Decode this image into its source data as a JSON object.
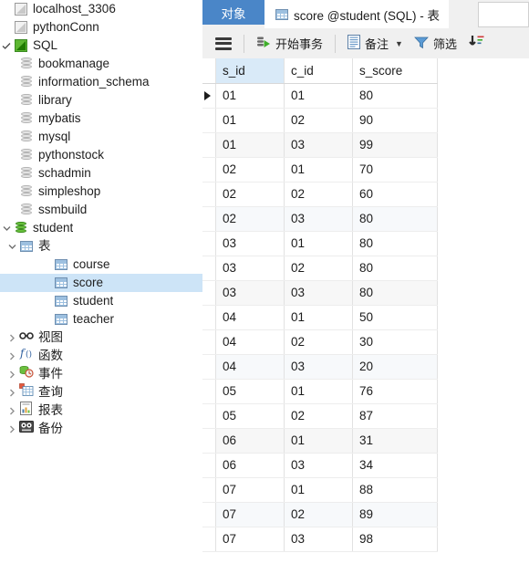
{
  "sidebar": {
    "items": [
      {
        "label": "localhost_3306",
        "icon": "connection-icon",
        "icon_state": "inactive",
        "twisty": "none",
        "indent": 22,
        "selected": false
      },
      {
        "label": "pythonConn",
        "icon": "connection-icon",
        "icon_state": "inactive",
        "twisty": "none",
        "indent": 22,
        "selected": false
      },
      {
        "label": "SQL",
        "icon": "connection-icon",
        "icon_state": "active",
        "twisty": "check",
        "indent": 22,
        "selected": false
      },
      {
        "label": "bookmanage",
        "icon": "database-icon",
        "icon_state": "closed",
        "twisty": "none",
        "indent": 42,
        "selected": false
      },
      {
        "label": "information_schema",
        "icon": "database-icon",
        "icon_state": "closed",
        "twisty": "none",
        "indent": 42,
        "selected": false
      },
      {
        "label": "library",
        "icon": "database-icon",
        "icon_state": "closed",
        "twisty": "none",
        "indent": 42,
        "selected": false
      },
      {
        "label": "mybatis",
        "icon": "database-icon",
        "icon_state": "closed",
        "twisty": "none",
        "indent": 42,
        "selected": false
      },
      {
        "label": "mysql",
        "icon": "database-icon",
        "icon_state": "closed",
        "twisty": "none",
        "indent": 42,
        "selected": false
      },
      {
        "label": "pythonstock",
        "icon": "database-icon",
        "icon_state": "closed",
        "twisty": "none",
        "indent": 42,
        "selected": false
      },
      {
        "label": "schadmin",
        "icon": "database-icon",
        "icon_state": "closed",
        "twisty": "none",
        "indent": 42,
        "selected": false
      },
      {
        "label": "simpleshop",
        "icon": "database-icon",
        "icon_state": "closed",
        "twisty": "none",
        "indent": 42,
        "selected": false
      },
      {
        "label": "ssmbuild",
        "icon": "database-icon",
        "icon_state": "closed",
        "twisty": "none",
        "indent": 42,
        "selected": false
      },
      {
        "label": "student",
        "icon": "database-icon",
        "icon_state": "open",
        "twisty": "down",
        "indent": 22,
        "selected": false
      },
      {
        "label": "表",
        "icon": "tables-folder-icon",
        "icon_state": "open",
        "twisty": "down",
        "indent": 42,
        "selected": false
      },
      {
        "label": "course",
        "icon": "table-icon",
        "icon_state": "",
        "twisty": "none",
        "indent": 80,
        "selected": false
      },
      {
        "label": "score",
        "icon": "table-icon",
        "icon_state": "",
        "twisty": "none",
        "indent": 80,
        "selected": true
      },
      {
        "label": "student",
        "icon": "table-icon",
        "icon_state": "",
        "twisty": "none",
        "indent": 80,
        "selected": false
      },
      {
        "label": "teacher",
        "icon": "table-icon",
        "icon_state": "",
        "twisty": "none",
        "indent": 80,
        "selected": false
      },
      {
        "label": "视图",
        "icon": "view-icon",
        "icon_state": "",
        "twisty": "right",
        "indent": 42,
        "selected": false
      },
      {
        "label": "函数",
        "icon": "function-icon",
        "icon_state": "",
        "twisty": "right",
        "indent": 42,
        "selected": false
      },
      {
        "label": "事件",
        "icon": "event-icon",
        "icon_state": "",
        "twisty": "right",
        "indent": 42,
        "selected": false
      },
      {
        "label": "查询",
        "icon": "query-icon",
        "icon_state": "",
        "twisty": "right",
        "indent": 42,
        "selected": false
      },
      {
        "label": "报表",
        "icon": "report-icon",
        "icon_state": "",
        "twisty": "right",
        "indent": 42,
        "selected": false
      },
      {
        "label": "备份",
        "icon": "backup-icon",
        "icon_state": "",
        "twisty": "right",
        "indent": 42,
        "selected": false
      }
    ]
  },
  "tabs": {
    "object_tab": "对象",
    "document_tab": "score @student (SQL) - 表"
  },
  "toolbar": {
    "menu_label": "",
    "begin_transaction": "开始事务",
    "note": "备注",
    "filter": "筛选",
    "sort": ""
  },
  "grid": {
    "columns": [
      "s_id",
      "c_id",
      "s_score"
    ],
    "highlighted_column": "s_id",
    "current_row_index": 0,
    "rows": [
      {
        "s_id": "01",
        "c_id": "01",
        "s_score": "80"
      },
      {
        "s_id": "01",
        "c_id": "02",
        "s_score": "90"
      },
      {
        "s_id": "01",
        "c_id": "03",
        "s_score": "99"
      },
      {
        "s_id": "02",
        "c_id": "01",
        "s_score": "70"
      },
      {
        "s_id": "02",
        "c_id": "02",
        "s_score": "60"
      },
      {
        "s_id": "02",
        "c_id": "03",
        "s_score": "80"
      },
      {
        "s_id": "03",
        "c_id": "01",
        "s_score": "80"
      },
      {
        "s_id": "03",
        "c_id": "02",
        "s_score": "80"
      },
      {
        "s_id": "03",
        "c_id": "03",
        "s_score": "80"
      },
      {
        "s_id": "04",
        "c_id": "01",
        "s_score": "50"
      },
      {
        "s_id": "04",
        "c_id": "02",
        "s_score": "30"
      },
      {
        "s_id": "04",
        "c_id": "03",
        "s_score": "20"
      },
      {
        "s_id": "05",
        "c_id": "01",
        "s_score": "76"
      },
      {
        "s_id": "05",
        "c_id": "02",
        "s_score": "87"
      },
      {
        "s_id": "06",
        "c_id": "01",
        "s_score": "31"
      },
      {
        "s_id": "06",
        "c_id": "03",
        "s_score": "34"
      },
      {
        "s_id": "07",
        "c_id": "01",
        "s_score": "88"
      },
      {
        "s_id": "07",
        "c_id": "02",
        "s_score": "89"
      },
      {
        "s_id": "07",
        "c_id": "03",
        "s_score": "98"
      }
    ]
  },
  "colors": {
    "tab_active": "#4a86c8",
    "selection": "#cde4f7",
    "header_highlight": "#d9eaf8",
    "row_stripe_blue": "#f7f9fb",
    "row_stripe_gray": "#f7f7f7",
    "db_open_green": "#67c13b"
  }
}
